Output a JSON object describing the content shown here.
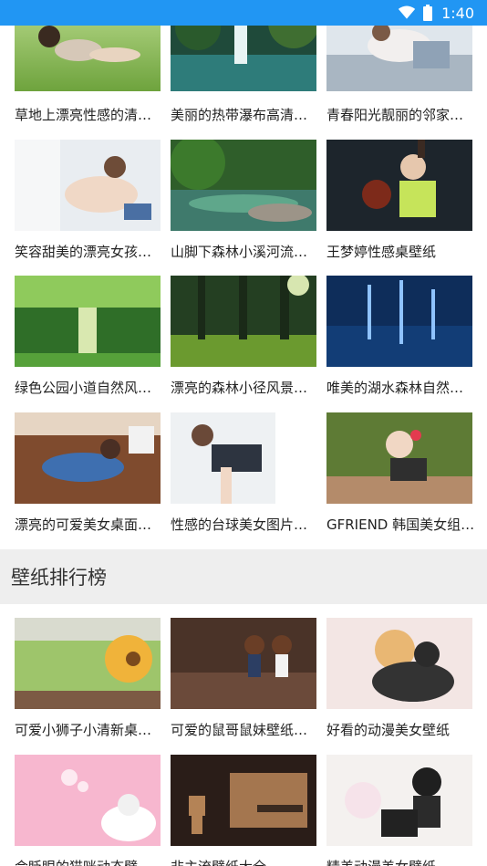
{
  "status_bar": {
    "time": "1:40",
    "icons": [
      "wifi-icon",
      "battery-icon"
    ],
    "color": "#2196f3"
  },
  "section1": {
    "items": [
      {
        "title": "草地上漂亮性感的清…",
        "thumb": "girl-on-grass"
      },
      {
        "title": "美丽的热带瀑布高清…",
        "thumb": "tropical-waterfall"
      },
      {
        "title": "青春阳光靓丽的邻家…",
        "thumb": "girl-in-kitchen"
      },
      {
        "title": "笑容甜美的漂亮女孩…",
        "thumb": "smiling-girl-curtains"
      },
      {
        "title": "山脚下森林小溪河流…",
        "thumb": "forest-stream"
      },
      {
        "title": "王梦婷性感桌壁纸",
        "thumb": "girl-rain-boxing"
      },
      {
        "title": "绿色公园小道自然风…",
        "thumb": "green-park-path"
      },
      {
        "title": "漂亮的森林小径风景…",
        "thumb": "forest-trail"
      },
      {
        "title": "唯美的湖水森林自然…",
        "thumb": "blue-lake-forest"
      },
      {
        "title": "漂亮的可爱美女桌面…",
        "thumb": "girl-on-sofa"
      },
      {
        "title": "性感的台球美女图片…",
        "thumb": "girl-window-light"
      },
      {
        "title": "GFRIEND 韩国美女组…",
        "thumb": "girl-headphones"
      }
    ]
  },
  "section2": {
    "title": "壁纸排行榜",
    "items": [
      {
        "title": "可爱小狮子小清新桌…",
        "thumb": "lion-toy-train"
      },
      {
        "title": "可爱的鼠哥鼠妹壁纸…",
        "thumb": "monchhichi-dolls"
      },
      {
        "title": "好看的动漫美女壁纸",
        "thumb": "anime-hug"
      },
      {
        "title": "会眨眼的猫咪动态壁…",
        "thumb": "pink-kitten"
      },
      {
        "title": "非主流壁纸大全",
        "thumb": "danboard"
      },
      {
        "title": "精美动漫美女壁纸",
        "thumb": "anime-girl-umbrella"
      }
    ]
  }
}
